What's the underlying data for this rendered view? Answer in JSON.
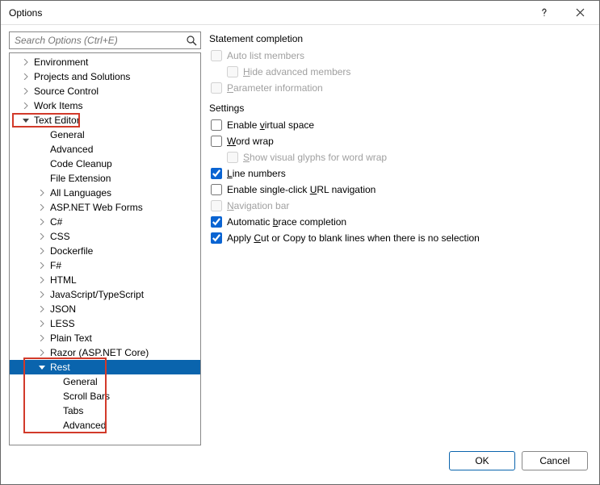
{
  "window": {
    "title": "Options"
  },
  "search": {
    "placeholder": "Search Options (Ctrl+E)"
  },
  "tree": {
    "environment": "Environment",
    "projects": "Projects and Solutions",
    "sourcecontrol": "Source Control",
    "workitems": "Work Items",
    "texteditor": "Text Editor",
    "general1": "General",
    "advanced1": "Advanced",
    "codecleanup": "Code Cleanup",
    "fileext": "File Extension",
    "alllang": "All Languages",
    "aspnet": "ASP.NET Web Forms",
    "csharp": "C#",
    "css": "CSS",
    "dockerfile": "Dockerfile",
    "fsharp": "F#",
    "html": "HTML",
    "jsts": "JavaScript/TypeScript",
    "json": "JSON",
    "less": "LESS",
    "plaintext": "Plain Text",
    "razor": "Razor (ASP.NET Core)",
    "rest": "Rest",
    "general2": "General",
    "scrollbars": "Scroll Bars",
    "tabs": "Tabs",
    "advanced2": "Advanced"
  },
  "panel": {
    "section1": "Statement completion",
    "autolist": "Auto list members",
    "hideadv": "Hide advanced members",
    "paraminfo": "Parameter information",
    "section2": "Settings",
    "virtualspace": "Enable virtual space",
    "wordwrap": "Word wrap",
    "glyphs": "Show visual glyphs for word wrap",
    "linenumbers": "Line numbers",
    "singleclick": "Enable single-click URL navigation",
    "navbar": "Navigation bar",
    "brace": "Automatic brace completion",
    "cutcopy": "Apply Cut or Copy to blank lines when there is no selection"
  },
  "footer": {
    "ok": "OK",
    "cancel": "Cancel"
  }
}
